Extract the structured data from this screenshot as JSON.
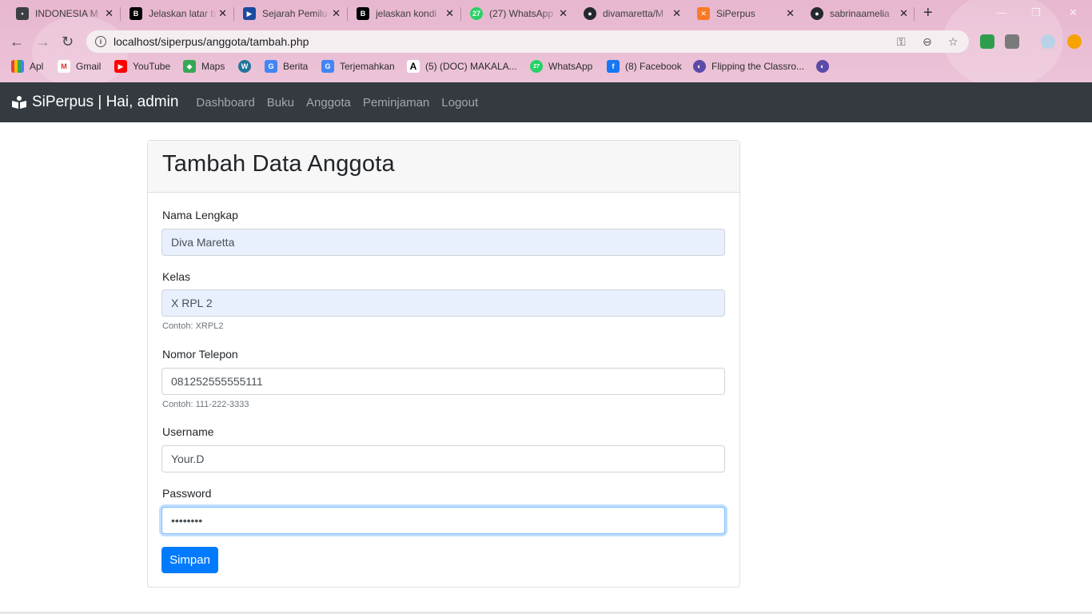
{
  "browser": {
    "tabs": [
      {
        "title": "INDONESIA M",
        "icon": "contact-icon",
        "color": "#3c4043"
      },
      {
        "title": "Jelaskan latar b",
        "icon": "brainly-icon",
        "color": "#000000"
      },
      {
        "title": "Sejarah Pemilu",
        "icon": "play-icon",
        "color": "#1b4aa0"
      },
      {
        "title": "jelaskan kondi",
        "icon": "brainly-icon",
        "color": "#000000"
      },
      {
        "title": "(27) WhatsApp",
        "icon": "whatsapp-icon",
        "color": "#25d366",
        "badge": "27"
      },
      {
        "title": "divamaretta/M",
        "icon": "github-icon",
        "color": "#24292e"
      },
      {
        "title": "SiPerpus",
        "icon": "xampp-icon",
        "color": "#fb7a24"
      },
      {
        "title": "sabrinaamelia",
        "icon": "github-icon",
        "color": "#24292e"
      }
    ],
    "url": "localhost/siperpus/anggota/tambah.php",
    "bookmarks": [
      {
        "label": "Apl",
        "icon": "apps-grid-icon"
      },
      {
        "label": "Gmail",
        "icon": "gmail-icon"
      },
      {
        "label": "YouTube",
        "icon": "youtube-icon"
      },
      {
        "label": "Maps",
        "icon": "maps-icon"
      },
      {
        "label": "",
        "icon": "wordpress-icon"
      },
      {
        "label": "Berita",
        "icon": "news-icon"
      },
      {
        "label": "Terjemahkan",
        "icon": "translate-icon"
      },
      {
        "label": "(5) (DOC) MAKALA...",
        "icon": "academia-icon"
      },
      {
        "label": "WhatsApp",
        "icon": "whatsapp-icon",
        "badge": "27"
      },
      {
        "label": "(8) Facebook",
        "icon": "facebook-icon"
      },
      {
        "label": "Flipping the Classro...",
        "icon": "globe-icon"
      },
      {
        "label": "",
        "icon": "globe-icon"
      }
    ]
  },
  "app": {
    "brand": "SiPerpus | Hai, admin",
    "nav": [
      "Dashboard",
      "Buku",
      "Anggota",
      "Peminjaman",
      "Logout"
    ]
  },
  "form": {
    "title": "Tambah Data Anggota",
    "nama_label": "Nama Lengkap",
    "nama_value": "Diva Maretta",
    "kelas_label": "Kelas",
    "kelas_value": "X RPL 2",
    "kelas_hint": "Contoh: XRPL2",
    "telp_label": "Nomor Telepon",
    "telp_value": "081252555555111",
    "telp_hint": "Contoh: 111-222-3333",
    "username_label": "Username",
    "username_value": "Your.D",
    "password_label": "Password",
    "password_value": "••••••••",
    "submit_label": "Simpan"
  },
  "colors": {
    "navbar": "#343a40",
    "primary": "#007bff",
    "autofill": "#e8f0fe"
  }
}
